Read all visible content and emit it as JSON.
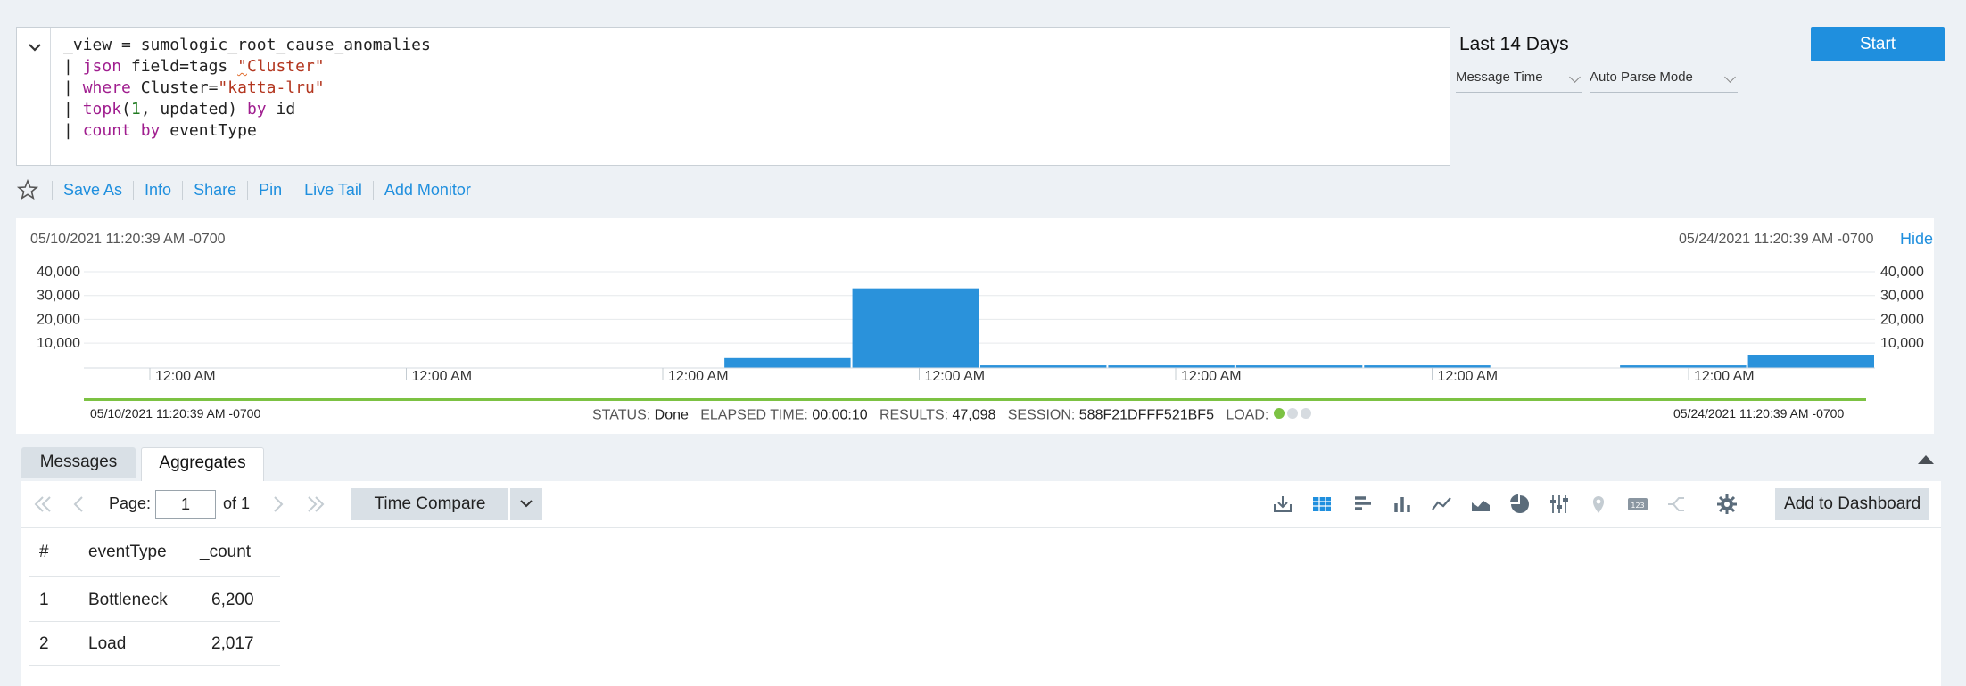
{
  "query": {
    "lines": [
      [
        {
          "t": "_view = sumologic_root_cause_anomalies",
          "c": ""
        }
      ],
      [
        {
          "t": "| ",
          "c": ""
        },
        {
          "t": "json",
          "c": "kw"
        },
        {
          "t": " field=tags ",
          "c": ""
        },
        {
          "t": "\"",
          "c": "str sq"
        },
        {
          "t": "Cluster\"",
          "c": "str"
        }
      ],
      [
        {
          "t": "| ",
          "c": ""
        },
        {
          "t": "where",
          "c": "kw"
        },
        {
          "t": " Cluster=",
          "c": ""
        },
        {
          "t": "\"katta-lru\"",
          "c": "str"
        }
      ],
      [
        {
          "t": "| ",
          "c": ""
        },
        {
          "t": "topk",
          "c": "kw"
        },
        {
          "t": "(",
          "c": ""
        },
        {
          "t": "1",
          "c": "num"
        },
        {
          "t": ", updated) ",
          "c": ""
        },
        {
          "t": "by",
          "c": "kw"
        },
        {
          "t": " id",
          "c": ""
        }
      ],
      [
        {
          "t": "| ",
          "c": ""
        },
        {
          "t": "count",
          "c": "kw"
        },
        {
          "t": " ",
          "c": ""
        },
        {
          "t": "by",
          "c": "kw"
        },
        {
          "t": " eventType",
          "c": ""
        }
      ]
    ]
  },
  "time_range": {
    "label": "Last 14 Days",
    "time_mode": "Message Time",
    "parse_mode": "Auto Parse Mode"
  },
  "start_button": "Start",
  "actions": [
    "Save As",
    "Info",
    "Share",
    "Pin",
    "Live Tail",
    "Add Monitor"
  ],
  "histogram": {
    "start": "05/10/2021 11:20:39 AM -0700",
    "end": "05/24/2021 11:20:39 AM -0700",
    "hide": "Hide",
    "bottom_start": "05/10/2021 11:20:39 AM -0700",
    "bottom_end": "05/24/2021 11:20:39 AM -0700",
    "status_label": "STATUS:",
    "status_value": "Done",
    "elapsed_label": "ELAPSED TIME:",
    "elapsed_value": "00:00:10",
    "results_label": "RESULTS:",
    "results_value": "47,098",
    "session_label": "SESSION:",
    "session_value": "588F21DFFF521BF5",
    "load_label": "LOAD:"
  },
  "chart_data": {
    "type": "bar",
    "y_ticks": [
      "40,000",
      "30,000",
      "20,000",
      "10,000"
    ],
    "x_ticks": [
      "12:00 AM",
      "12:00 AM",
      "12:00 AM",
      "12:00 AM",
      "12:00 AM",
      "12:00 AM",
      "12:00 AM"
    ],
    "ylim": [
      0,
      40000
    ],
    "values": [
      0,
      0,
      0,
      0,
      0,
      4200,
      33500,
      1100,
      1100,
      1100,
      1100,
      0,
      1100,
      5300
    ],
    "color": "#2a92db"
  },
  "tabs": {
    "messages": "Messages",
    "aggregates": "Aggregates"
  },
  "pager": {
    "page_label": "Page:",
    "page_value": "1",
    "of_label": "of 1",
    "time_compare": "Time Compare",
    "add_to_dashboard": "Add to Dashboard"
  },
  "table": {
    "headers": [
      "#",
      "eventType",
      "_count"
    ],
    "rows": [
      [
        "1",
        "Bottleneck",
        "6,200"
      ],
      [
        "2",
        "Load",
        "2,017"
      ]
    ]
  }
}
